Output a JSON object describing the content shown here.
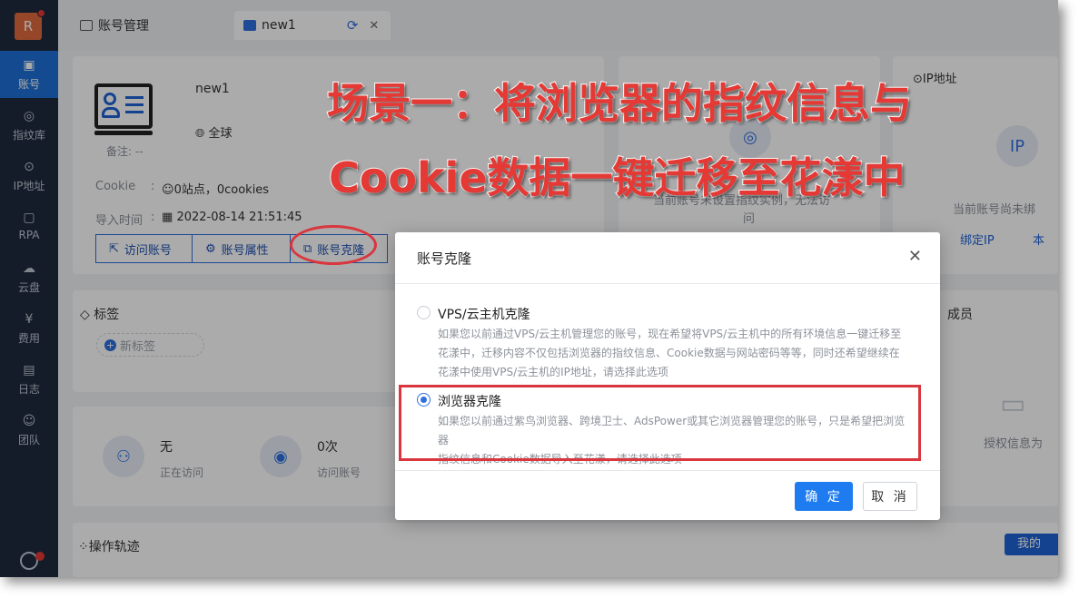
{
  "app": {
    "logo_letter": "R"
  },
  "sidebar": {
    "items": [
      {
        "label": "账号",
        "icon": "id-card-icon",
        "active": true
      },
      {
        "label": "指纹库",
        "icon": "fingerprint-icon"
      },
      {
        "label": "IP地址",
        "icon": "ip-icon"
      },
      {
        "label": "RPA",
        "icon": "robot-icon"
      },
      {
        "label": "云盘",
        "icon": "cloud-drive-icon"
      },
      {
        "label": "费用",
        "icon": "yen-icon"
      },
      {
        "label": "日志",
        "icon": "log-icon"
      },
      {
        "label": "团队",
        "icon": "team-icon"
      }
    ]
  },
  "tabs": [
    {
      "label": "账号管理"
    },
    {
      "label": "new1"
    }
  ],
  "account": {
    "name": "new1",
    "region": "全球",
    "note_label": "备注: --",
    "cookie_label": "Cookie",
    "cookie_colon": ":",
    "cookie_value": "0站点，0cookies",
    "import_label": "导入时间",
    "import_colon": ":",
    "import_value": "2022-08-14 21:51:45",
    "buttons": [
      "访问账号",
      "账号属性",
      "账号克隆"
    ]
  },
  "fingerprint_panel": {
    "text_line1": "当前账号未设置指纹实例，无法访",
    "text_line2": "问"
  },
  "ip_panel": {
    "title": "IP地址",
    "text": "当前账号尚未绑",
    "bind_label": "绑定IP",
    "extra_label": "本"
  },
  "tags_panel": {
    "title": "标签",
    "new_tag": "新标签"
  },
  "members_panel": {
    "title": "成员",
    "empty_text": "授权信息为"
  },
  "stats": [
    {
      "value": "无",
      "label": "正在访问"
    },
    {
      "value": "0次",
      "label": "访问账号"
    }
  ],
  "track_panel": {
    "title": "操作轨迹"
  },
  "right_badge": "我的",
  "modal": {
    "title": "账号克隆",
    "options": [
      {
        "title": "VPS/云主机克隆",
        "checked": false,
        "desc": [
          "如果您以前通过VPS/云主机管理您的账号，现在希望将VPS/云主机中的所有环境信息一键迁移至",
          "花漾中，迁移内容不仅包括浏览器的指纹信息、Cookie数据与网站密码等等，同时还希望继续在",
          "花漾中使用VPS/云主机的IP地址，请选择此选项"
        ]
      },
      {
        "title": "浏览器克隆",
        "checked": true,
        "desc": [
          "如果您以前通过紫鸟浏览器、跨境卫士、AdsPower或其它浏览器管理您的账号，只是希望把浏览器",
          "指纹信息和Cookie数据导入至花漾，请选择此选项"
        ]
      }
    ],
    "confirm_label": "确 定",
    "cancel_label": "取 消"
  },
  "caption": {
    "line1": "场景一：将浏览器的指纹信息与",
    "line2": "Cookie数据一键迁移至花漾中"
  },
  "colors": {
    "accent": "#1e7cf0",
    "sidebar_bg": "#1d2a3d",
    "annotation_red": "#d9363e"
  }
}
